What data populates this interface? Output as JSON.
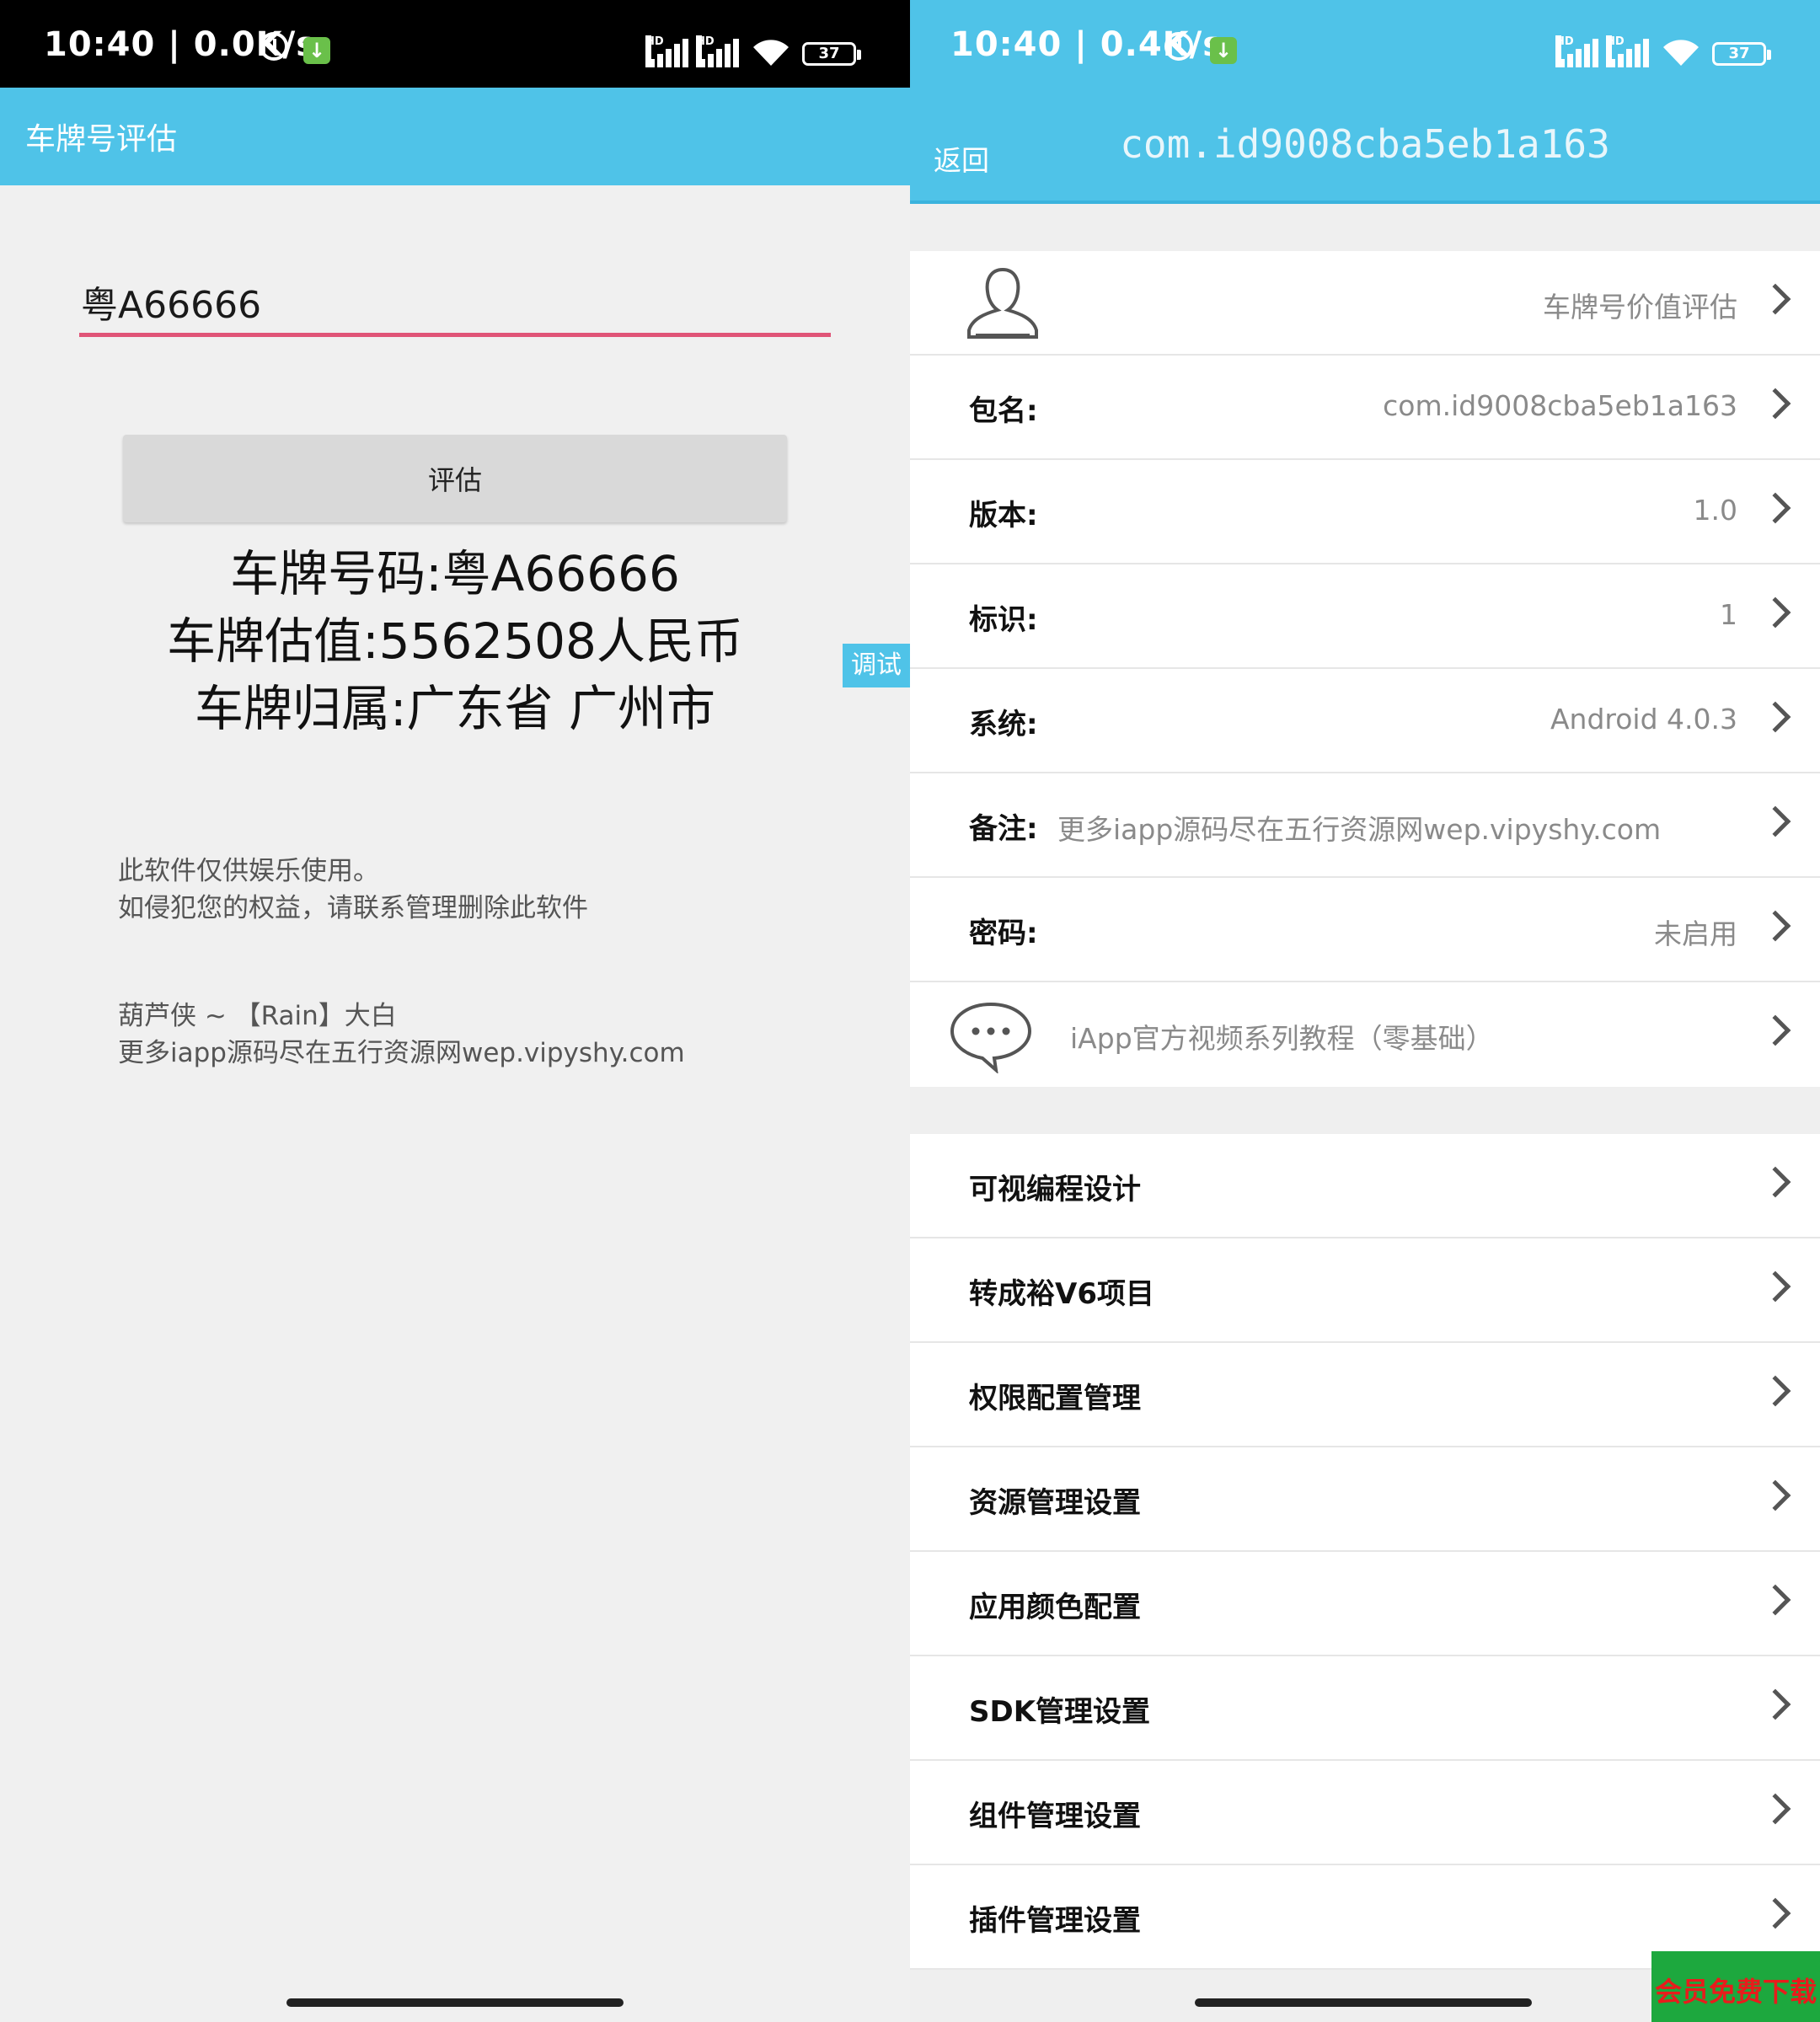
{
  "left": {
    "status": {
      "time": "10:40 | 0.0K/s",
      "battery": "37"
    },
    "title": "车牌号评估",
    "plate_input_value": "粤A66666",
    "eval_button": "评估",
    "results": [
      "车牌号码:粤A66666",
      "车牌估值:5562508人民币",
      "车牌归属:广东省 广州市"
    ],
    "disclaimer": [
      "此软件仅供娱乐使用。",
      "如侵犯您的权益，请联系管理删除此软件"
    ],
    "credits": [
      "葫芦侠 ~ 【Rain】大白",
      "更多iapp源码尽在五行资源网wep.vipyshy.com"
    ],
    "debug_tab": "调试"
  },
  "right": {
    "status": {
      "time": "10:40 | 0.4K/s",
      "battery": "37"
    },
    "back": "返回",
    "title": "com.id9008cba5eb1a163",
    "header_row_value": "车牌号价值评估",
    "info_rows": [
      {
        "label": "包名:",
        "value": "com.id9008cba5eb1a163"
      },
      {
        "label": "版本:",
        "value": "1.0"
      },
      {
        "label": "标识:",
        "value": "1"
      },
      {
        "label": "系统:",
        "value": "Android 4.0.3"
      }
    ],
    "remark_row": {
      "label": "备注:",
      "value": "更多iapp源码尽在五行资源网wep.vipyshy.com"
    },
    "password_row": {
      "label": "密码:",
      "value": "未启用"
    },
    "tutorial_link": "iApp官方视频系列教程（零基础）",
    "menu_items": [
      "可视编程设计",
      "转成裕V6项目",
      "权限配置管理",
      "资源管理设置",
      "应用颜色配置",
      "SDK管理设置",
      "组件管理设置",
      "插件管理设置"
    ],
    "badge": "会员免费下载"
  },
  "colors": {
    "accent_blue": "#4fc3e8",
    "input_underline": "#e05477",
    "badge_green": "#1da83e",
    "badge_text_red": "#e81c1c"
  },
  "icons": [
    "alarm-icon",
    "download-icon",
    "signal-icon",
    "wifi-icon",
    "battery-icon",
    "user-icon",
    "chat-icon",
    "chevron-right-icon"
  ]
}
